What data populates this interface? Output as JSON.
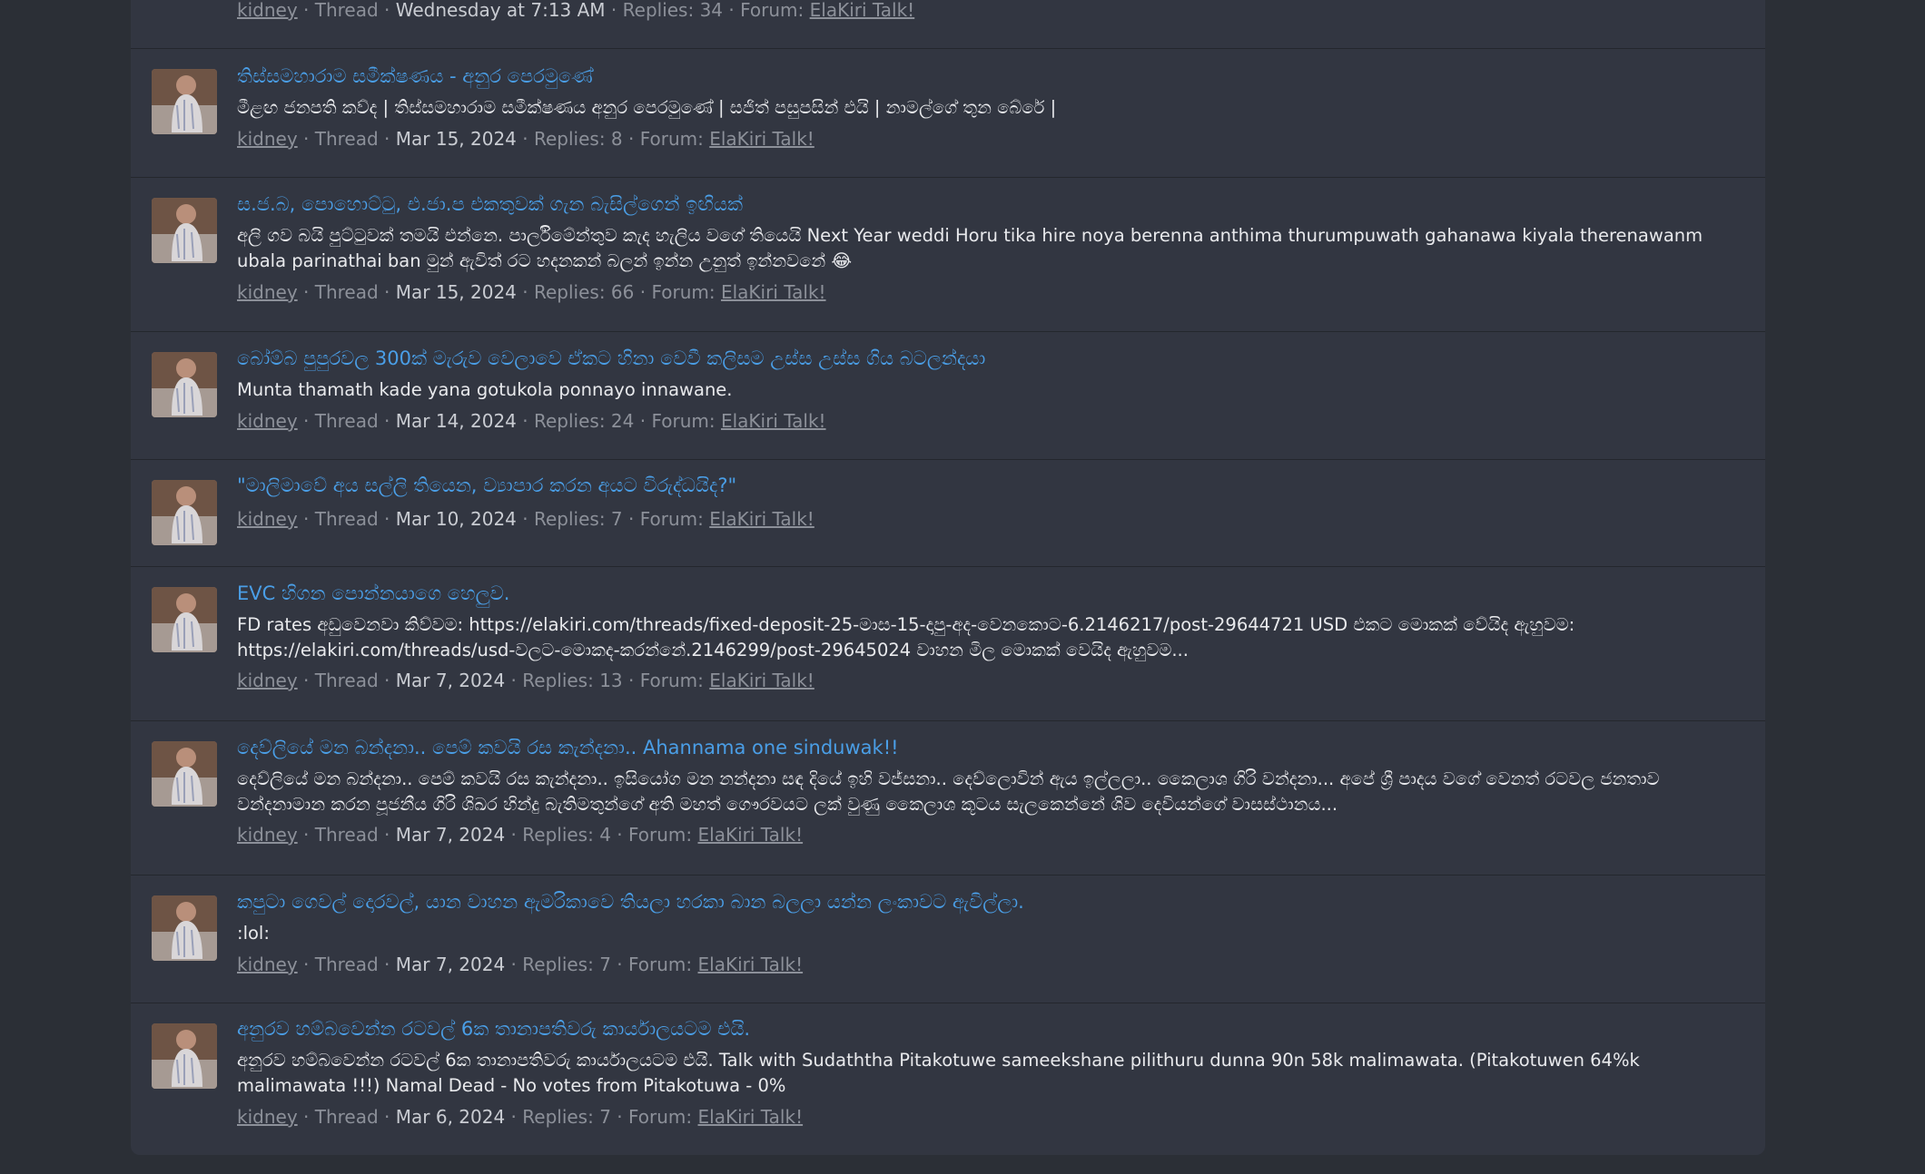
{
  "threads": [
    {
      "title": "",
      "snippet": "",
      "author": "kidney",
      "type": "Thread",
      "date": "Wednesday at 7:13 AM",
      "replies": "Replies: 34",
      "forum_label": "Forum:",
      "forum": "ElaKiri Talk!"
    },
    {
      "title": "තිස්සමහාරාම සමීක්ෂණය - අනුර පෙරමුණේ",
      "snippet": "මීළඟ ජනපති කව්ද | තිස්සමහාරාම සමීක්ෂණය අනුර පෙරමුණේ | සජිත් පසුපසින් එයි | නාමල්ගේ තුන බේරේ |",
      "author": "kidney",
      "type": "Thread",
      "date": "Mar 15, 2024",
      "replies": "Replies: 8",
      "forum_label": "Forum:",
      "forum": "ElaKiri Talk!"
    },
    {
      "title": "ස.ජ.බ, පොහොට්ටු, එ.ජා.ප එකතුවක් ගැන බැසිල්ගෙන් ඉඟියක්",
      "snippet": "අලි ගව බයි පුට්ටුවක් තමයි එන්නෙ. පාර්ලිමේන්තුව කැද හැලිය වගේ තියෙයි Next Year weddi Horu tika hire noya berenna anthima thurumpuwath gahanawa kiyala therenawanm ubala parinathai ban මුන් ඇවිත් රට හදනකන් බලන් ඉන්න උනුත් ඉන්නවනේ 😂",
      "author": "kidney",
      "type": "Thread",
      "date": "Mar 15, 2024",
      "replies": "Replies: 66",
      "forum_label": "Forum:",
      "forum": "ElaKiri Talk!"
    },
    {
      "title": "බෝම්බ පුපුරවල 300ක් මැරුව වෙලාවෙ ඒකට හිනා වෙවී කලිසම උස්ස උස්ස ගිය බටලන්දයා",
      "snippet": "Munta thamath kade yana gotukola ponnayo innawane.",
      "author": "kidney",
      "type": "Thread",
      "date": "Mar 14, 2024",
      "replies": "Replies: 24",
      "forum_label": "Forum:",
      "forum": "ElaKiri Talk!"
    },
    {
      "title": "\"මාලිමාවේ අය සල්ලි තියෙන, ව්‍යාපාර කරන අයට විරුද්ධයිද?\"",
      "snippet": "",
      "author": "kidney",
      "type": "Thread",
      "date": "Mar 10, 2024",
      "replies": "Replies: 7",
      "forum_label": "Forum:",
      "forum": "ElaKiri Talk!"
    },
    {
      "title": "EVC හිගන පොන්නයාගෙ හෙලුව.",
      "snippet": "FD rates අඩුවෙනවා කිව්වම: https://elakiri.com/threads/fixed-deposit-25-මාස-15-දාපු-අද-වෙනකොට-6.2146217/post-29644721 USD එකට මොකක් වේයිද ඇහුවම: https://elakiri.com/threads/usd-වලට-මොකද-කරන්නේ.2146299/post-29645024 වාහන මිල මොකක් වෙයිද ඇහුවම...",
      "author": "kidney",
      "type": "Thread",
      "date": "Mar 7, 2024",
      "replies": "Replies: 13",
      "forum_label": "Forum:",
      "forum": "ElaKiri Talk!"
    },
    {
      "title": "දෙව්ලියේ මන බන්දනා.. පෙම් කවයි රස කැන්දනා.. Ahannama one sinduwak!!",
      "snippet": "දෙව්ලියේ මන බන්දනා.. පෙම් කවයි රස කැන්දනා.. ඉසියෝග මන නන්දනා සඳ දියේ ඉහි වජ්සනා.. දෙව්ලොවින් ඇය ඉල්ලලා.. කෛලාශ ගිරි වන්දනා... අපේ ශ්‍රී පාදය වගේ වෙනත් රටවල ජනතාව වන්දනාමාන කරන පූජනීය ගිරි ශිඛර හින්දු බැතිමතුන්ගේ අති මහත් ගෞරවයට ලක් වුණු කෛලාශ කූටය සැලකෙන්නේ ශිව දෙවියන්ගේ වාසස්ථානය...",
      "author": "kidney",
      "type": "Thread",
      "date": "Mar 7, 2024",
      "replies": "Replies: 4",
      "forum_label": "Forum:",
      "forum": "ElaKiri Talk!"
    },
    {
      "title": "කපුටා ගෙවල් දොරවල්, යාන වාහන ඇමරිකාවෙ තියලා හරකා බාන බලලා යන්න ලංකාවට ඇවිල්ලා.",
      "snippet": ":lol:",
      "author": "kidney",
      "type": "Thread",
      "date": "Mar 7, 2024",
      "replies": "Replies: 7",
      "forum_label": "Forum:",
      "forum": "ElaKiri Talk!"
    },
    {
      "title": "අනුරව හම්බවෙන්න රටවල් 6ක තානාපතිවරු කාර්යාලයටම එයි.",
      "snippet": "අනුරව හම්බවෙන්න රටවල් 6ක තානාපතිවරු කාර්යාලයටම එයි. Talk with Sudaththa Pitakotuwe sameekshane pilithuru dunna 90n 58k malimawata. (Pitakotuwen 64%k malimawata !!!) Namal Dead - No votes from Pitakotuwa - 0%",
      "author": "kidney",
      "type": "Thread",
      "date": "Mar 6, 2024",
      "replies": "Replies: 7",
      "forum_label": "Forum:",
      "forum": "ElaKiri Talk!"
    }
  ]
}
